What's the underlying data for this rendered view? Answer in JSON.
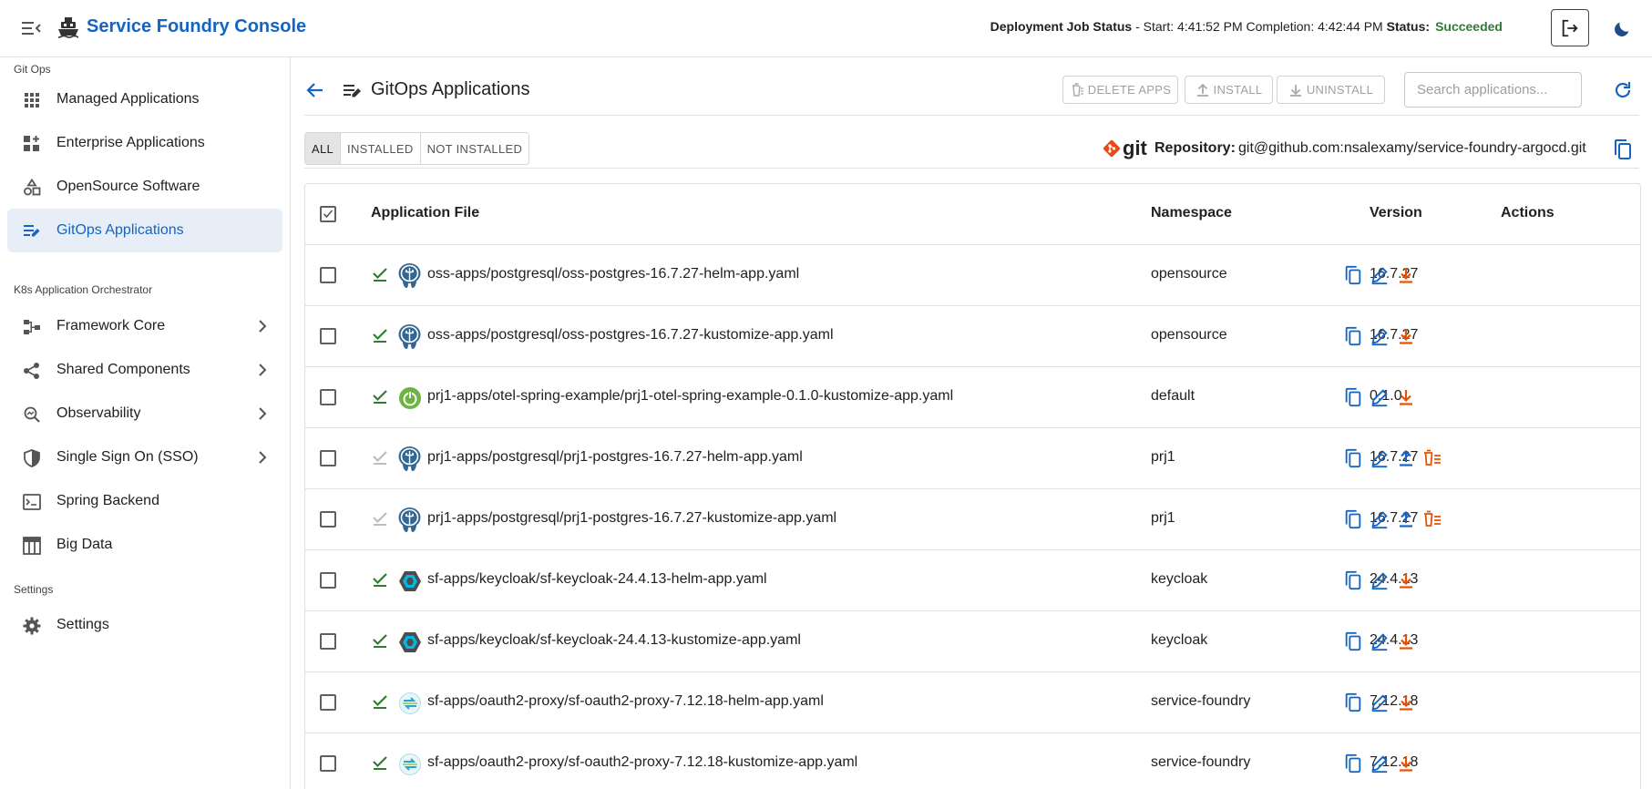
{
  "header": {
    "title": "Service Foundry Console",
    "job_label": "Deployment Job Status",
    "job_sep": " - ",
    "start_text": "Start: 4:41:52 PM",
    "completion_text": "Completion: 4:42:44 PM",
    "status_label": "Status:",
    "status_value": "Succeeded"
  },
  "sidebar": {
    "sections": [
      "Git Ops",
      "K8s Application Orchestrator",
      "Settings"
    ],
    "items": [
      {
        "label": "Managed Applications",
        "icon": "apps-grid-icon"
      },
      {
        "label": "Enterprise Applications",
        "icon": "dashboard-add-icon"
      },
      {
        "label": "OpenSource Software",
        "icon": "shapes-icon"
      },
      {
        "label": "GitOps Applications",
        "icon": "edit-list-icon",
        "active": true
      },
      {
        "label": "Framework Core",
        "icon": "hub-icon"
      },
      {
        "label": "Shared Components",
        "icon": "share-icon"
      },
      {
        "label": "Observability",
        "icon": "search-insights-icon"
      },
      {
        "label": "Single Sign On (SSO)",
        "icon": "shield-icon"
      },
      {
        "label": "Spring Backend",
        "icon": "terminal-icon"
      },
      {
        "label": "Big Data",
        "icon": "table-icon"
      },
      {
        "label": "Settings",
        "icon": "gear-icon"
      }
    ]
  },
  "page": {
    "title": "GitOps Applications",
    "buttons": {
      "delete": "DELETE APPS",
      "install": "INSTALL",
      "uninstall": "UNINSTALL"
    },
    "search_placeholder": "Search applications...",
    "filters": [
      "ALL",
      "INSTALLED",
      "NOT INSTALLED"
    ],
    "active_filter": "ALL",
    "git_word": "git",
    "repo_label": "Repository:",
    "repo_value": "git@github.com:nsalexamy/service-foundry-argocd.git"
  },
  "table": {
    "headers": {
      "file": "Application File",
      "namespace": "Namespace",
      "version": "Version",
      "actions": "Actions"
    },
    "rows": [
      {
        "file": "oss-apps/postgresql/oss-postgres-16.7.27-helm-app.yaml",
        "namespace": "opensource",
        "version": "16.7.27",
        "installed": true,
        "icon": "postgresql-icon"
      },
      {
        "file": "oss-apps/postgresql/oss-postgres-16.7.27-kustomize-app.yaml",
        "namespace": "opensource",
        "version": "16.7.27",
        "installed": true,
        "icon": "postgresql-icon"
      },
      {
        "file": "prj1-apps/otel-spring-example/prj1-otel-spring-example-0.1.0-kustomize-app.yaml",
        "namespace": "default",
        "version": "0.1.0",
        "installed": true,
        "icon": "spring-icon"
      },
      {
        "file": "prj1-apps/postgresql/prj1-postgres-16.7.27-helm-app.yaml",
        "namespace": "prj1",
        "version": "16.7.27",
        "installed": false,
        "icon": "postgresql-icon"
      },
      {
        "file": "prj1-apps/postgresql/prj1-postgres-16.7.27-kustomize-app.yaml",
        "namespace": "prj1",
        "version": "16.7.27",
        "installed": false,
        "icon": "postgresql-icon"
      },
      {
        "file": "sf-apps/keycloak/sf-keycloak-24.4.13-helm-app.yaml",
        "namespace": "keycloak",
        "version": "24.4.13",
        "installed": true,
        "icon": "keycloak-icon"
      },
      {
        "file": "sf-apps/keycloak/sf-keycloak-24.4.13-kustomize-app.yaml",
        "namespace": "keycloak",
        "version": "24.4.13",
        "installed": true,
        "icon": "keycloak-icon"
      },
      {
        "file": "sf-apps/oauth2-proxy/sf-oauth2-proxy-7.12.18-helm-app.yaml",
        "namespace": "service-foundry",
        "version": "7.12.18",
        "installed": true,
        "icon": "oauth2-proxy-icon"
      },
      {
        "file": "sf-apps/oauth2-proxy/sf-oauth2-proxy-7.12.18-kustomize-app.yaml",
        "namespace": "service-foundry",
        "version": "7.12.18",
        "installed": true,
        "icon": "oauth2-proxy-icon"
      }
    ]
  },
  "colors": {
    "brand": "#1565c0",
    "success": "#2e7d32",
    "warn": "#e65100",
    "nav_active_bg": "#e8eef7"
  }
}
